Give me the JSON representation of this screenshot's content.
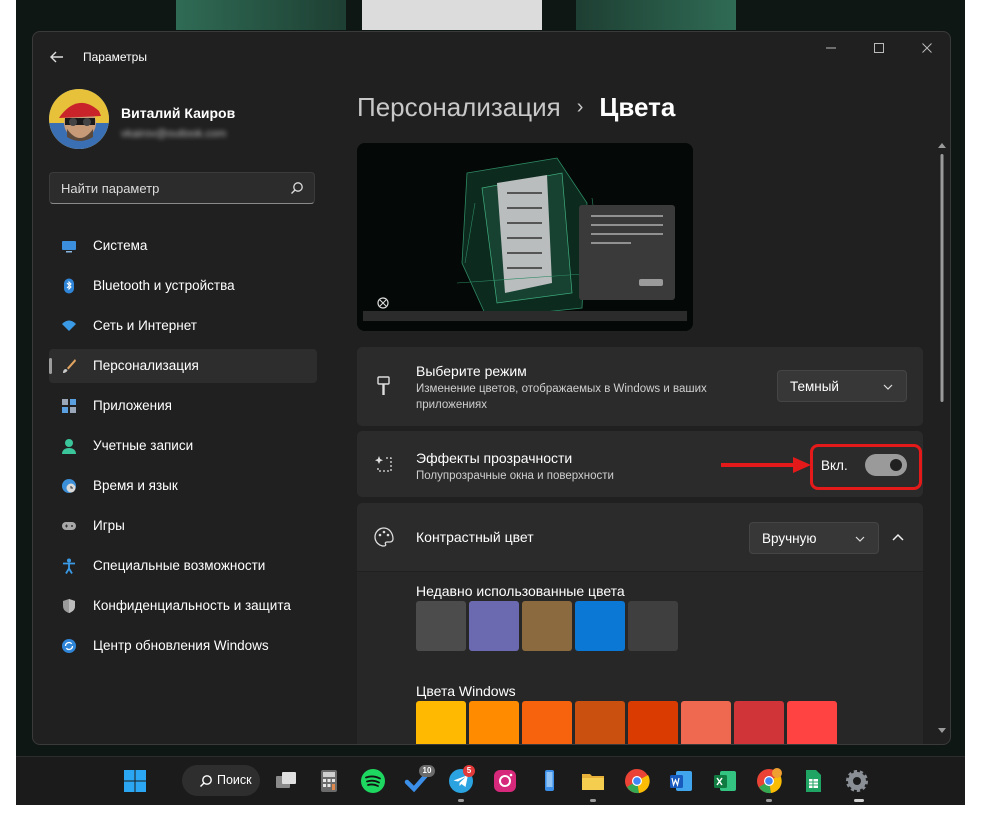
{
  "window": {
    "title": "Параметры"
  },
  "user": {
    "name": "Виталий Каиров",
    "email": "vkairov@outlook.com"
  },
  "search": {
    "placeholder": "Найти параметр"
  },
  "sidebar": {
    "items": [
      {
        "label": "Система",
        "icon": "monitor-icon"
      },
      {
        "label": "Bluetooth и устройства",
        "icon": "bluetooth-icon"
      },
      {
        "label": "Сеть и Интернет",
        "icon": "wifi-icon"
      },
      {
        "label": "Персонализация",
        "icon": "paintbrush-icon",
        "selected": true
      },
      {
        "label": "Приложения",
        "icon": "apps-icon"
      },
      {
        "label": "Учетные записи",
        "icon": "person-icon"
      },
      {
        "label": "Время и язык",
        "icon": "globe-clock-icon"
      },
      {
        "label": "Игры",
        "icon": "gamepad-icon"
      },
      {
        "label": "Специальные возможности",
        "icon": "accessibility-icon"
      },
      {
        "label": "Конфиденциальность и защита",
        "icon": "shield-icon"
      },
      {
        "label": "Центр обновления Windows",
        "icon": "update-icon"
      }
    ]
  },
  "breadcrumb": {
    "parent": "Персонализация",
    "separator": "›",
    "current": "Цвета"
  },
  "mode": {
    "title": "Выберите режим",
    "description_line1": "Изменение цветов, отображаемых в Windows и ваших",
    "description_line2": "приложениях",
    "value": "Темный"
  },
  "transparency": {
    "title": "Эффекты прозрачности",
    "description": "Полупрозрачные окна и поверхности",
    "state_label": "Вкл.",
    "enabled": true
  },
  "accent": {
    "title": "Контрастный цвет",
    "value": "Вручную",
    "recent_label": "Недавно использованные цвета",
    "recent_colors": [
      "#4c4c4c",
      "#6b69b0",
      "#8a6a3e",
      "#0b78d6",
      "#3f3f3f"
    ],
    "windows_label": "Цвета Windows",
    "windows_colors": [
      "#ffb900",
      "#ff8c00",
      "#f7630c",
      "#ca5010",
      "#da3b01",
      "#ef6950",
      "#d13438",
      "#ff4343"
    ]
  },
  "colors": {
    "highlight": "#e41a1a",
    "window_bg": "#202020",
    "card_bg": "#2b2b2b"
  },
  "taskbar": {
    "search_label": "Поиск",
    "telegram_badge": "5",
    "checklist_badge": "10"
  }
}
